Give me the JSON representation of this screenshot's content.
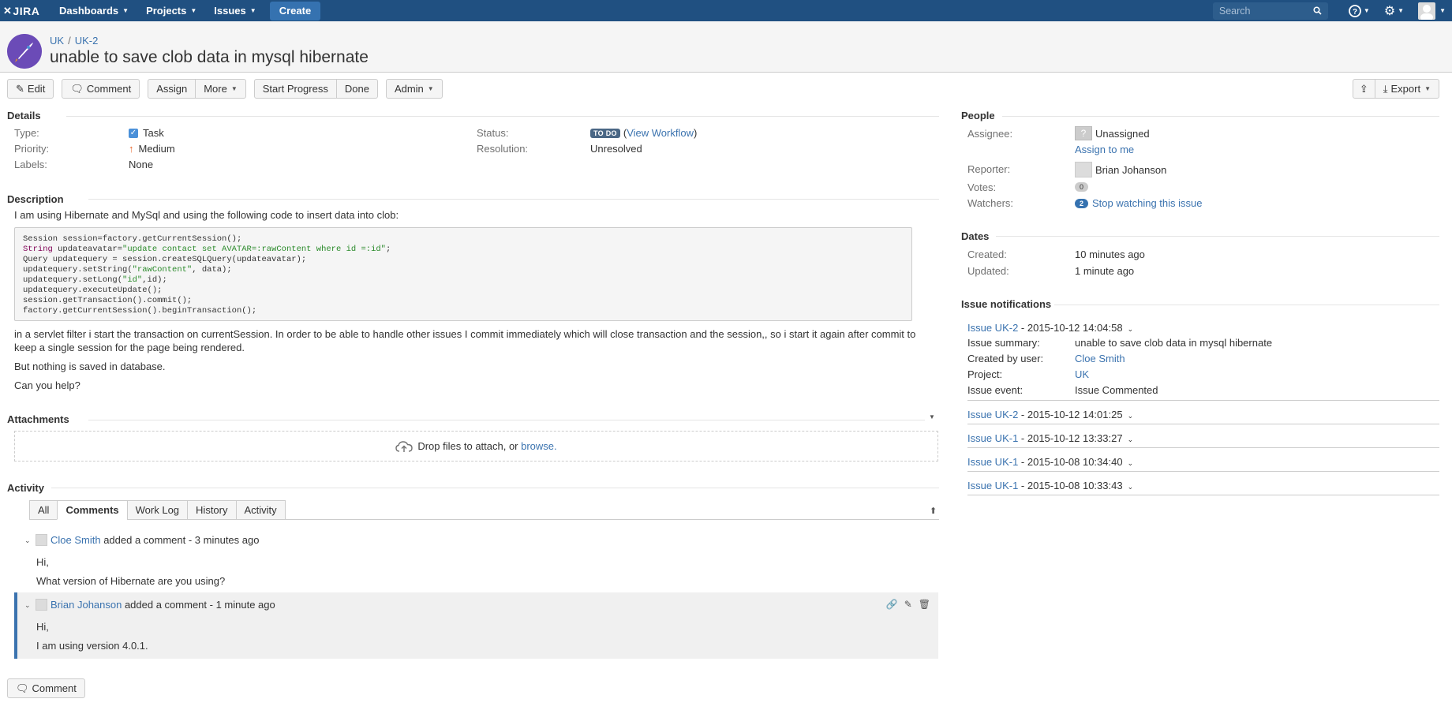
{
  "nav": {
    "logo": "JIRA",
    "menus": [
      {
        "label": "Dashboards"
      },
      {
        "label": "Projects"
      },
      {
        "label": "Issues"
      }
    ],
    "create_label": "Create",
    "search_placeholder": "Search"
  },
  "issue": {
    "breadcrumb": [
      "UK",
      "UK-2"
    ],
    "summary": "unable to save clob data in mysql hibernate"
  },
  "toolbar": {
    "edit": "Edit",
    "comment": "Comment",
    "assign": "Assign",
    "more": "More",
    "start_progress": "Start Progress",
    "done": "Done",
    "admin": "Admin",
    "export": "Export"
  },
  "details": {
    "heading": "Details",
    "type_label": "Type:",
    "type_value": "Task",
    "priority_label": "Priority:",
    "priority_value": "Medium",
    "labels_label": "Labels:",
    "labels_value": "None",
    "status_label": "Status:",
    "status_value": "TO DO",
    "view_workflow": "View Workflow",
    "resolution_label": "Resolution:",
    "resolution_value": "Unresolved"
  },
  "description": {
    "heading": "Description",
    "intro": "I am using Hibernate and MySql and using the following code to insert data into clob:",
    "code": {
      "l1": "Session session=factory.getCurrentSession();",
      "l2_kw": "String",
      "l2_a": " updateavatar=",
      "l2_str": "\"update contact set AVATAR=:rawContent where id =:id\"",
      "l2_b": ";",
      "l3": "Query updatequery = session.createSQLQuery(updateavatar);",
      "l4_a": "updatequery.setString(",
      "l4_str": "\"rawContent\"",
      "l4_b": ", data);",
      "l5_a": "updatequery.setLong(",
      "l5_str": "\"id\"",
      "l5_b": ",id);",
      "l6": "updatequery.executeUpdate();",
      "l7": "session.getTransaction().commit();",
      "l8": "factory.getCurrentSession().beginTransaction();"
    },
    "para1": "in a servlet filter i start the transaction on currentSession. In order to be able to handle other issues I commit immediately which will close transaction and the session,, so i start it again after commit to keep a single session for the page being rendered.",
    "para2": "But nothing is saved in database.",
    "para3": "Can you help?"
  },
  "attachments": {
    "heading": "Attachments",
    "drop_text": "Drop files to attach, or ",
    "browse": "browse."
  },
  "activity": {
    "heading": "Activity",
    "tabs": [
      "All",
      "Comments",
      "Work Log",
      "History",
      "Activity"
    ],
    "active_tab": "Comments",
    "comments": [
      {
        "author": "Cloe Smith",
        "meta": " added a comment - 3 minutes ago",
        "line1": "Hi,",
        "line2": "What version of Hibernate are you using?"
      },
      {
        "author": "Brian Johanson",
        "meta": " added a comment - 1 minute ago",
        "line1": "Hi,",
        "line2": "I am using version 4.0.1."
      }
    ],
    "comment_button": "Comment"
  },
  "people": {
    "heading": "People",
    "assignee_label": "Assignee:",
    "assignee_value": "Unassigned",
    "assign_to_me": "Assign to me",
    "reporter_label": "Reporter:",
    "reporter_value": "Brian Johanson",
    "votes_label": "Votes:",
    "votes_count": "0",
    "watchers_label": "Watchers:",
    "watchers_count": "2",
    "stop_watching": "Stop watching this issue"
  },
  "dates": {
    "heading": "Dates",
    "created_label": "Created:",
    "created_value": "10 minutes ago",
    "updated_label": "Updated:",
    "updated_value": "1 minute ago"
  },
  "notifications": {
    "heading": "Issue notifications",
    "expanded": {
      "issue": "Issue UK-2",
      "when": " - 2015-10-12 14:04:58",
      "summary_label": "Issue summary:",
      "summary_value": "unable to save clob data in mysql hibernate",
      "created_by_label": "Created by user:",
      "created_by_value": "Cloe Smith",
      "project_label": "Project:",
      "project_value": "UK",
      "event_label": "Issue event:",
      "event_value": "Issue Commented"
    },
    "items": [
      {
        "issue": "Issue UK-2",
        "when": " - 2015-10-12 14:01:25"
      },
      {
        "issue": "Issue UK-1",
        "when": " - 2015-10-12 13:33:27"
      },
      {
        "issue": "Issue UK-1",
        "when": " - 2015-10-08 10:34:40"
      },
      {
        "issue": "Issue UK-1",
        "when": " - 2015-10-08 10:33:43"
      }
    ]
  }
}
